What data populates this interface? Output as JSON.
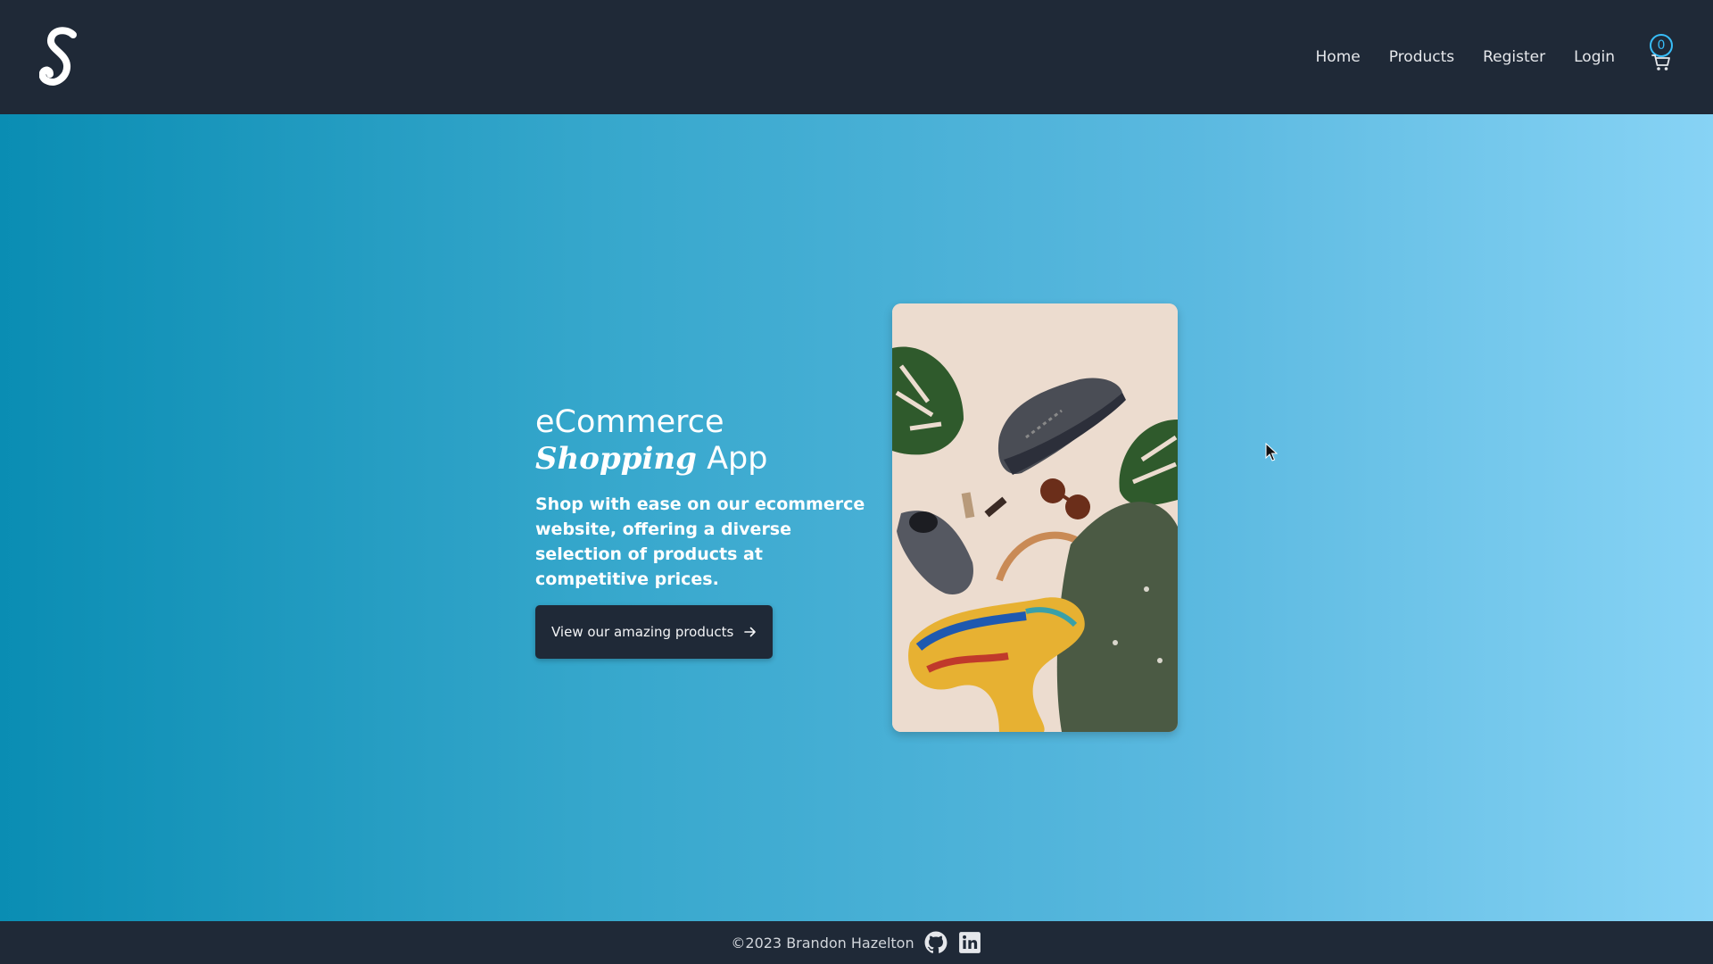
{
  "colors": {
    "navbar_bg": "#1f2937",
    "accent": "#38bdf8",
    "hero_gradient_start": "#0a8db3",
    "hero_gradient_end": "#87d3f5",
    "button_bg": "#1f2937"
  },
  "header": {
    "logo_letter": "S",
    "nav": [
      {
        "label": "Home"
      },
      {
        "label": "Products"
      },
      {
        "label": "Register"
      },
      {
        "label": "Login"
      }
    ],
    "cart_count": "0",
    "cart_icon": "shopping-cart-icon"
  },
  "hero": {
    "title_line1": "eCommerce",
    "title_script": "Shopping",
    "title_end": "App",
    "subtitle": "Shop with ease on our ecommerce website, offering a diverse selection of products at competitive prices.",
    "cta_label": "View our amazing products",
    "cta_icon": "arrow-right-icon"
  },
  "footer": {
    "copyright": "©2023 Brandon Hazelton",
    "icons": [
      "github-icon",
      "linkedin-icon"
    ]
  }
}
